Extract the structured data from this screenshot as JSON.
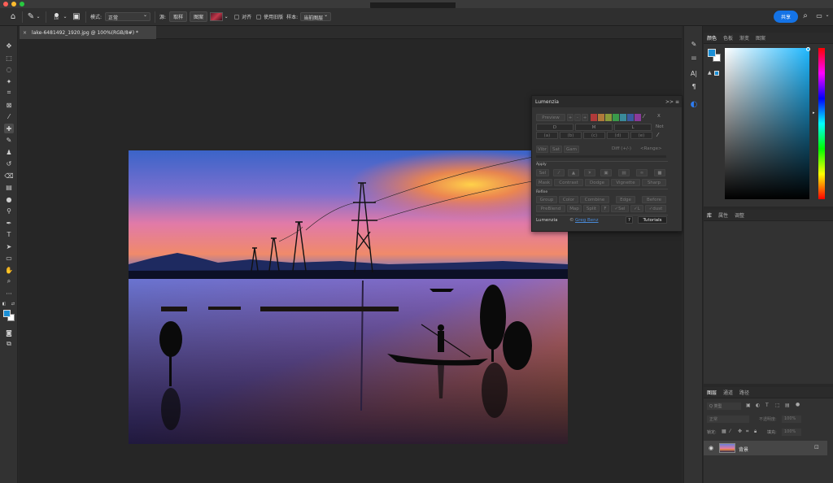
{
  "optbar": {
    "brush_size": "18",
    "mode_label": "模式:",
    "mode_value": "正常",
    "source_label": "源:",
    "sample_btn": "取样",
    "pattern_btn": "图案",
    "align_label": "对齐",
    "legacy_label": "使用旧版",
    "sample_label": "样本:",
    "sample_value": "当前图层",
    "share_label": "共享"
  },
  "doc_tab": {
    "close": "×",
    "title": "lake-6481492_1920.jpg @ 100%(RGB/8#) *"
  },
  "color_panel": {
    "tabs": [
      "颜色",
      "色板",
      "渐变",
      "图案"
    ],
    "foreground": "#1a8fd6",
    "background": "#ffffff"
  },
  "mid_panel": {
    "tabs": [
      "库",
      "属性",
      "调整"
    ]
  },
  "layers_panel": {
    "tabs": [
      "图层",
      "通道",
      "路径"
    ],
    "filter_label": "Q 类型",
    "blend_mode": "正常",
    "opacity_label": "不透明度:",
    "opacity_value": "100%",
    "lock_label": "锁定:",
    "fill_label": "填充:",
    "fill_value": "100%",
    "layer_name": "背景"
  },
  "lumenzia": {
    "title": "Lumenzia",
    "collapse": ">>",
    "preview": "Preview",
    "plus": "+",
    "minus": "-",
    "x": "X",
    "zone_top": [
      "D",
      "M",
      "L"
    ],
    "not": "Not",
    "zone_bottom": [
      "(a)",
      "(b)",
      "(c)",
      "(d)",
      "(e)"
    ],
    "row_vibr": [
      "Vibr",
      "Sat",
      "Gam"
    ],
    "diff": "Diff (+/-)",
    "range": "<Range>",
    "apply_label": "Apply",
    "sel": "Sel",
    "apply_row2": [
      "Mask",
      "Contrast",
      "Dodge",
      "Vignette",
      "Sharp"
    ],
    "refine_label": "Refine",
    "refine_row1": [
      "Group",
      "Color",
      "Combine",
      "Edge",
      "Before"
    ],
    "refine_row2": [
      "PreBlend",
      "Map",
      "Split",
      "F",
      "✓Sel",
      "✓L",
      "✓dust"
    ],
    "footer_name": "Lumenzia",
    "footer_author": "Greg Benz",
    "help": "?",
    "tutorials": "Tutorials",
    "swatches": [
      "#b03a3a",
      "#b07a3a",
      "#8a9a3a",
      "#3a9a4a",
      "#3a8a9a",
      "#3a5aa0",
      "#8a3a9a"
    ]
  }
}
